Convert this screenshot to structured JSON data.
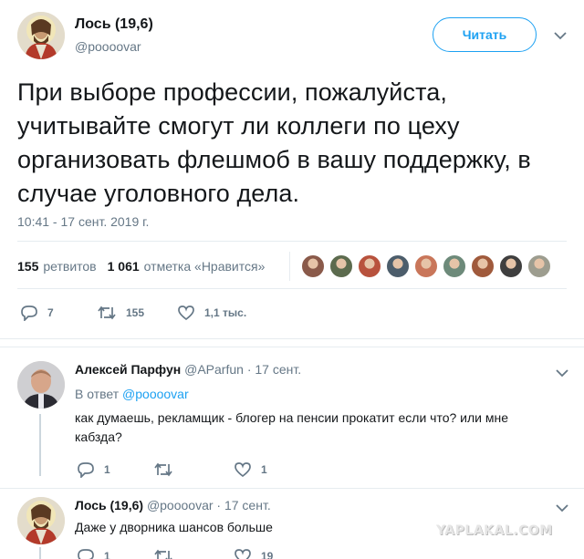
{
  "tweet": {
    "author_name": "Лось (19,6)",
    "author_handle": "@poooovar",
    "follow_label": "Читать",
    "text": "При выборе профессии, пожалуйста, учитывайте смогут ли коллеги по цеху организовать флешмоб в вашу поддержку, в случае уголовного дела.",
    "timestamp": "10:41 - 17 сент. 2019 г.",
    "retweets_count": "155",
    "retweets_label": "ретвитов",
    "likes_count": "1 061",
    "likes_label": "отметка «Нравится»",
    "likers": [
      {
        "color": "#8a5a4a"
      },
      {
        "color": "#5c6b4e"
      },
      {
        "color": "#b8523d"
      },
      {
        "color": "#4c5d6b"
      },
      {
        "color": "#c9765a"
      },
      {
        "color": "#6d8a7a"
      },
      {
        "color": "#a05a3c"
      },
      {
        "color": "#3f3f3f"
      },
      {
        "color": "#9d9d8f"
      }
    ],
    "actions": {
      "replies": "7",
      "retweets": "155",
      "likes": "1,1 тыс."
    }
  },
  "replies": [
    {
      "author_name": "Алексей Парфун",
      "author_handle": "@AParfun",
      "date": "· 17 сент.",
      "reply_to_prefix": "В ответ",
      "reply_to_handle": "@poooovar",
      "text": "как думаешь, рекламщик - блогер на пенсии прокатит если что? или мне кабзда?",
      "actions": {
        "replies": "1",
        "retweets": "",
        "likes": "1"
      }
    },
    {
      "author_name": "Лось (19,6)",
      "author_handle": "@poooovar",
      "date": "· 17 сент.",
      "text": "Даже у дворника шансов больше",
      "actions": {
        "replies": "1",
        "retweets": "",
        "likes": "19"
      }
    }
  ],
  "watermark": "YAPLAKAL.COM",
  "colors": {
    "accent": "#1da1f2",
    "muted": "#657786",
    "text": "#14171a",
    "divider": "#e6ecf0"
  }
}
